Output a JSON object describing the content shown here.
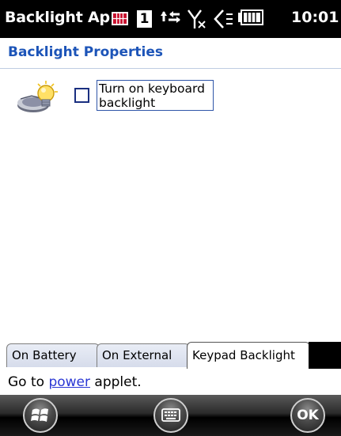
{
  "statusbar": {
    "app_title": "Backlight Ap",
    "sim_number": "1",
    "time": "10:01",
    "icons": [
      "sim-card-icon",
      "sim-slot-icon",
      "data-connection-icon",
      "no-signal-icon",
      "volume-icon",
      "battery-icon"
    ]
  },
  "header": {
    "title": "Backlight Properties"
  },
  "content": {
    "icon": "lightbulb-icon",
    "checkbox_label": "Turn on keyboard backlight",
    "checked": false
  },
  "tabs": [
    {
      "label": "On Battery",
      "active": false
    },
    {
      "label": "On External",
      "active": false
    },
    {
      "label": "Keypad Backlight",
      "active": true
    }
  ],
  "footer": {
    "prefix": "Go to ",
    "link": "power",
    "suffix": " applet."
  },
  "softkeys": {
    "start_icon": "windows-start-icon",
    "keyboard_icon": "keyboard-icon",
    "ok_label": "OK"
  },
  "colors": {
    "title_blue": "#1c54b8",
    "link_blue": "#2a37d4",
    "bar_black": "#000000"
  }
}
